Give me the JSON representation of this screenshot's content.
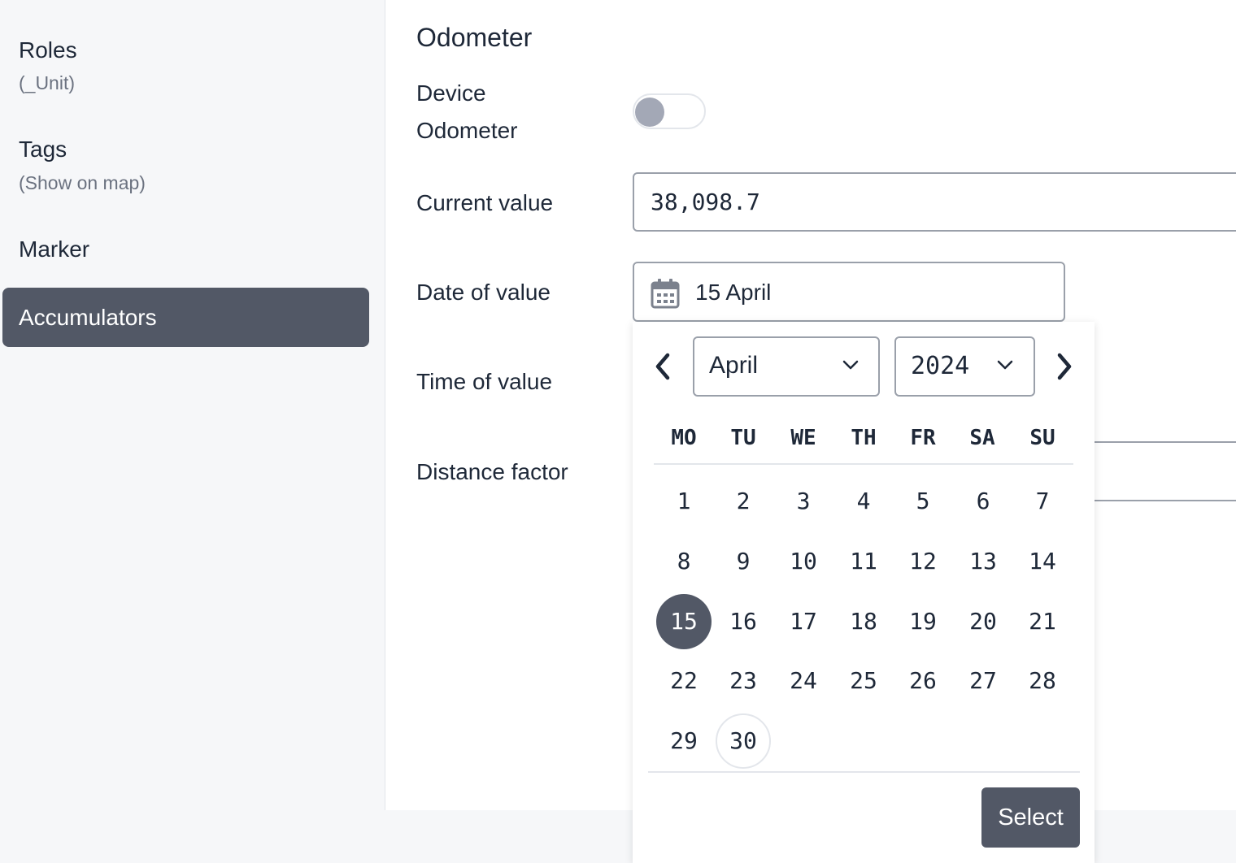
{
  "sidebar": {
    "roles": {
      "label": "Roles",
      "sub": "(_Unit)"
    },
    "tags": {
      "label": "Tags",
      "sub": "(Show on map)"
    },
    "marker": {
      "label": "Marker"
    },
    "accumulators": {
      "label": "Accumulators"
    }
  },
  "form": {
    "section_title": "Odometer",
    "device_odometer_line1": "Device",
    "device_odometer_line2": "Odometer",
    "device_odometer_enabled": false,
    "current_value_label": "Current value",
    "current_value": "38,098.7",
    "date_label": "Date of value",
    "date_value": "15 April",
    "time_label": "Time of value",
    "distance_label": "Distance factor"
  },
  "picker": {
    "month": "April",
    "year": "2024",
    "weekdays": [
      "MO",
      "TU",
      "WE",
      "TH",
      "FR",
      "SA",
      "SU"
    ],
    "days": [
      "1",
      "2",
      "3",
      "4",
      "5",
      "6",
      "7",
      "8",
      "9",
      "10",
      "11",
      "12",
      "13",
      "14",
      "15",
      "16",
      "17",
      "18",
      "19",
      "20",
      "21",
      "22",
      "23",
      "24",
      "25",
      "26",
      "27",
      "28",
      "29",
      "30"
    ],
    "selected_day": "15",
    "today_day": "30",
    "select_label": "Select"
  },
  "icons": [
    "calendar-icon",
    "chevron-left-icon",
    "chevron-right-icon",
    "chevron-down-icon"
  ],
  "colors": {
    "accent": "#525866",
    "border": "#9aa0aa",
    "sidebar_bg": "#f6f7f9"
  }
}
